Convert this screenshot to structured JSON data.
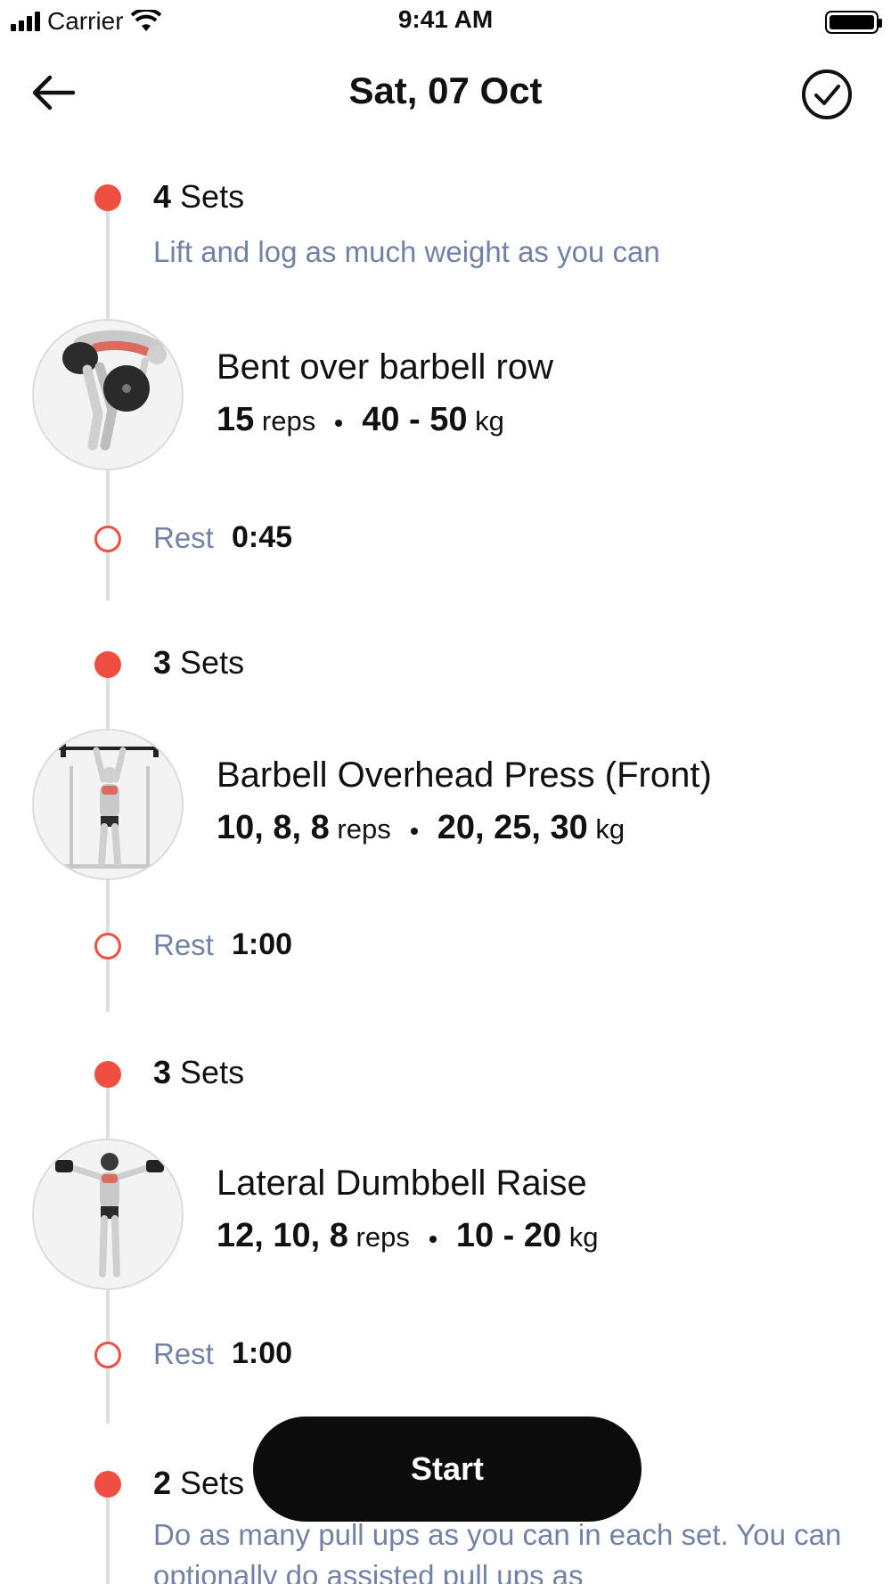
{
  "status_bar": {
    "carrier": "Carrier",
    "time": "9:41 AM"
  },
  "nav": {
    "title": "Sat, 07 Oct"
  },
  "blocks": [
    {
      "sets_count": "4",
      "sets_label": "Sets",
      "hint": "Lift and log as much weight as you can",
      "exercise": "Bent over barbell row",
      "reps": "15",
      "reps_unit": "reps",
      "weight": "40 - 50",
      "weight_unit": "kg",
      "rest_label": "Rest",
      "rest_value": "0:45"
    },
    {
      "sets_count": "3",
      "sets_label": "Sets",
      "exercise": "Barbell Overhead Press (Front)",
      "reps": "10, 8, 8",
      "reps_unit": "reps",
      "weight": "20, 25, 30",
      "weight_unit": "kg",
      "rest_label": "Rest",
      "rest_value": "1:00"
    },
    {
      "sets_count": "3",
      "sets_label": "Sets",
      "exercise": "Lateral Dumbbell Raise",
      "reps": "12, 10, 8",
      "reps_unit": "reps",
      "weight": "10 - 20",
      "weight_unit": "kg",
      "rest_label": "Rest",
      "rest_value": "1:00"
    },
    {
      "sets_count": "2",
      "sets_label": "Sets",
      "hint": "Do as many pull ups as you can in each set. You can optionally do assisted pull ups as"
    }
  ],
  "start_button": {
    "label": "Start"
  },
  "colors": {
    "accent": "#ee4f40",
    "muted_text": "#7282a6",
    "button": "#0c0c0c"
  }
}
